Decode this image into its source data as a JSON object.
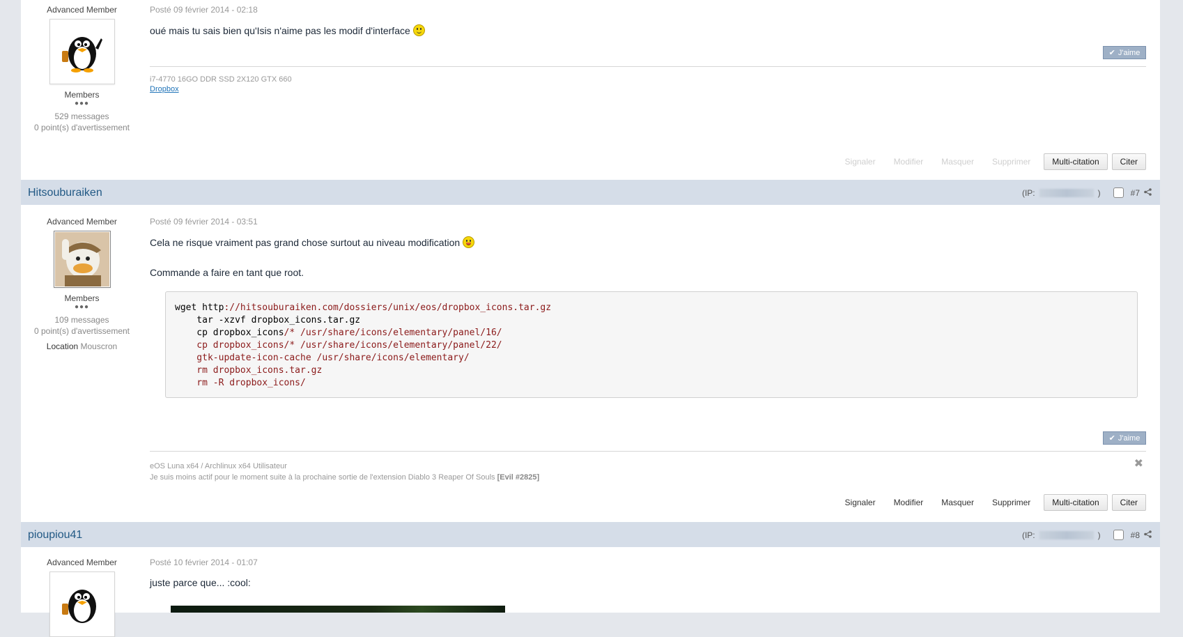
{
  "post6": {
    "group_title": "Advanced Member",
    "member_rank": "Members",
    "pips": "●●●",
    "posts_count": "529 messages",
    "warnings": "0 point(s) d'avertissement",
    "date": "Posté 09 février 2014 - 02:18",
    "text": "oué mais tu sais bien qu'Isis n'aime pas les modif d'interface",
    "like_label": "J'aime",
    "signature_line1": "i7-4770 16GO DDR SSD 2X120 GTX 660",
    "signature_link": "Dropbox",
    "actions": [
      "Signaler",
      "Modifier",
      "Masquer",
      "Supprimer"
    ],
    "multiquote": "Multi-citation",
    "quote": "Citer"
  },
  "post7": {
    "author": "Hitsouburaiken",
    "ip_prefix": "(IP:",
    "ip_suffix": ")",
    "number": "#7",
    "group_title": "Advanced Member",
    "member_rank": "Members",
    "pips": "●●●",
    "posts_count": "109 messages",
    "warnings": "0 point(s) d'avertissement",
    "location_label": "Location",
    "location_value": "Mouscron",
    "date": "Posté 09 février 2014 - 03:51",
    "text1": "Cela ne risque vraiment pas grand chose surtout au niveau modification",
    "text2": "Commande a faire en tant que root.",
    "code": {
      "l1_a": "wget http",
      "l1_b": "://hitsouburaiken.com/dossiers/unix/eos/dropbox_icons.tar.gz",
      "l2": "    tar -xzvf dropbox_icons.tar.gz",
      "l3_a": "    cp dropbox_icons",
      "l3_b": "/* /usr/share/icons/elementary/panel/16/",
      "l4": "    cp dropbox_icons/* /usr/share/icons/elementary/panel/22/",
      "l5": "    gtk-update-icon-cache /usr/share/icons/elementary/",
      "l6": "    rm dropbox_icons.tar.gz",
      "l7": "    rm -R dropbox_icons/"
    },
    "like_label": "J'aime",
    "signature_line1": "eOS Luna x64 / Archlinux x64 Utilisateur",
    "signature_line2": "Je suis moins actif pour le moment suite à la prochaine sortie de l'extension Diablo 3 Reaper Of Souls",
    "signature_bold": "[Evil #2825]",
    "actions": [
      "Signaler",
      "Modifier",
      "Masquer",
      "Supprimer"
    ],
    "multiquote": "Multi-citation",
    "quote": "Citer"
  },
  "post8": {
    "author": "pioupiou41",
    "ip_prefix": "(IP:",
    "ip_suffix": ")",
    "number": "#8",
    "group_title": "Advanced Member",
    "date": "Posté 10 février 2014 - 01:07",
    "text": "juste parce que... :cool:"
  },
  "icons": {
    "share": "share-icon",
    "like_check": "check-icon",
    "close": "close-icon"
  }
}
